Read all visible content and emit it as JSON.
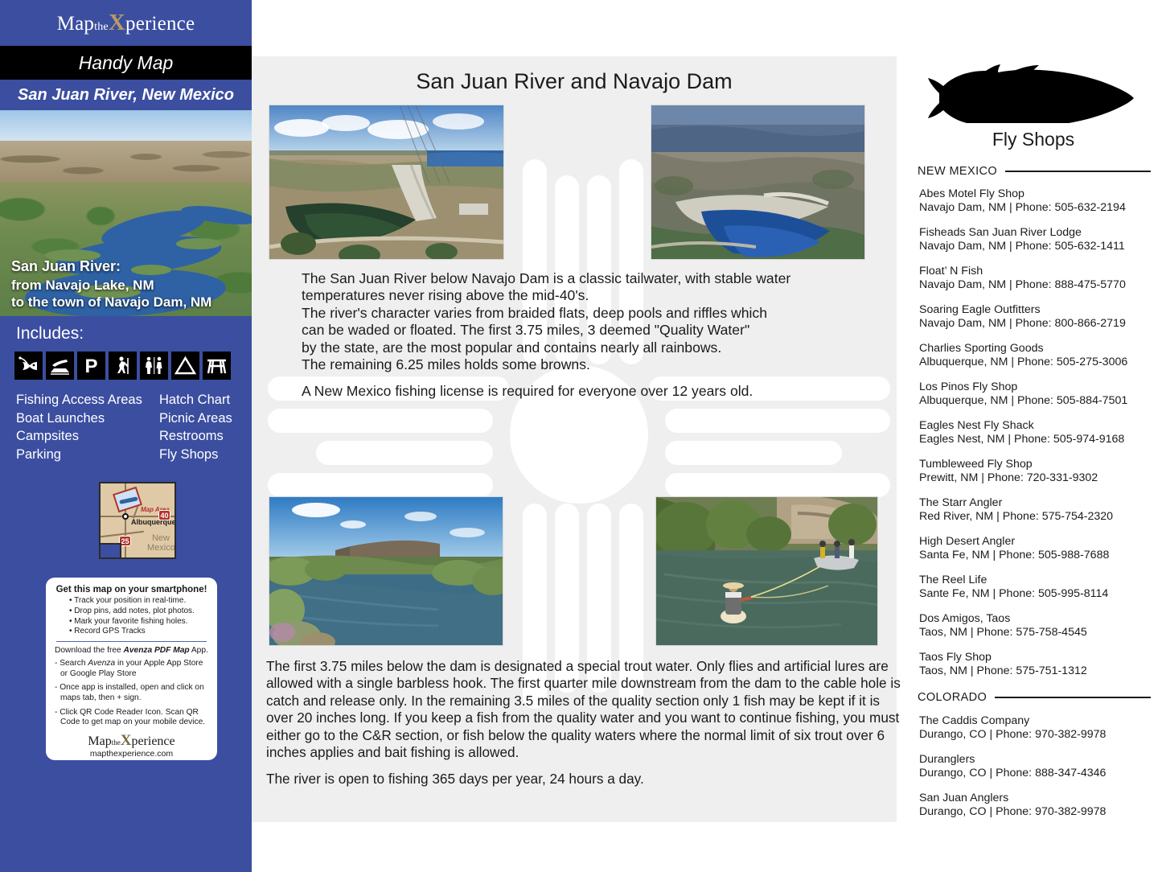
{
  "sidebar": {
    "brand": {
      "pre": "Map",
      "mid": "the",
      "x": "X",
      "post": "perience",
      "full": "MaptheXperience"
    },
    "handy_map": "Handy Map",
    "region_title": "San Juan River, New Mexico",
    "hero_caption": {
      "line1": "San Juan River:",
      "line2": "from Navajo Lake, NM",
      "line3": "to the town of Navajo Dam, NM"
    },
    "includes_label": "Includes:",
    "icons": [
      "fishing-icon",
      "boat-launch-icon",
      "parking-icon",
      "hiking-icon",
      "restrooms-icon",
      "camping-icon",
      "picnic-icon"
    ],
    "features_left": [
      "Fishing Access Areas",
      "Boat Launches",
      "Campsites",
      "Parking"
    ],
    "features_right": [
      "Hatch Chart",
      "Picnic Areas",
      "Restrooms",
      "Fly Shops"
    ],
    "state_map": {
      "map_area_label": "Map Area",
      "city": "Albuquerque",
      "state_line1": "New",
      "state_line2": "Mexico",
      "shield_40": "40",
      "shield_25": "25"
    },
    "promo": {
      "heading": "Get this map on your smartphone!",
      "bullets": [
        "Track your position in real-time.",
        "Drop pins, add notes, plot photos.",
        "Mark your favorite fishing holes.",
        "Record GPS Tracks"
      ],
      "download_pre": "Download the free ",
      "download_app": "Avenza PDF Map",
      "download_post": " App.",
      "steps": [
        "- Search Avenza in your Apple App Store or Google Play Store",
        "- Once app is installed, open and click on maps tab, then + sign.",
        "- Click QR Code Reader Icon. Scan QR Code to get map on your mobile device."
      ],
      "step1_pre": "- Search ",
      "step1_em": "Avenza",
      "step1_post": " in your Apple App Store or Google Play Store",
      "step2": "- Once app is installed, open and click on maps tab, then + sign.",
      "step3": "- Click QR Code Reader Icon. Scan QR Code to get map on your mobile device.",
      "url": "mapthexperience.com"
    }
  },
  "main": {
    "title": "San Juan River and Navajo Dam",
    "photos": [
      {
        "name": "navajo-dam-aerial-photo",
        "alt": "Aerial view of Navajo Dam spillway and reservoir"
      },
      {
        "name": "navajo-lake-aerial-photo",
        "alt": "Aerial view of Navajo Lake and canyon"
      },
      {
        "name": "san-juan-river-photo",
        "alt": "San Juan River with mesa backdrop"
      },
      {
        "name": "fly-angler-photo",
        "alt": "Fly angler wading with drift boat upstream"
      }
    ],
    "text_top": [
      "The San Juan River below Navajo Dam is a classic tailwater, with stable water temperatures never rising above the mid-40's.",
      "The river's character varies from braided flats, deep pools and riffles which can be waded or floated.  The first 3.75 miles, 3 deemed \"Quality Water\" by the state, are the most popular and contains nearly all rainbows.",
      "The remaining 6.25 miles holds some browns.",
      "A New Mexico fishing license is required for everyone over 12 years old."
    ],
    "text_top_lines": [
      "The San Juan River below Navajo Dam is a classic tailwater, with stable water",
      "temperatures never rising above the mid-40's.",
      "The river's character varies from braided flats, deep pools and riffles which",
      "can be waded or floated.  The first 3.75 miles, 3 deemed \"Quality Water\"",
      "by the state, are the most popular and contains nearly all rainbows.",
      "The remaining 6.25 miles holds some browns."
    ],
    "text_top_license": "A New Mexico fishing license is required for everyone over 12 years old.",
    "text_bottom_main": "The first 3.75 miles below the dam is designated a special trout water. Only flies and artificial lures are  allowed with a single barbless hook. The first quarter mile downstream from the dam to the cable hole is catch and release only. In the remaining 3.5 miles of the quality section only 1 fish may be kept if it is over 20 inches long. If you keep a fish from the quality water and you want to continue fishing, you must either go to the C&R section, or fish below the quality waters where the normal limit of six trout over 6 inches applies and bait fishing is allowed.",
    "text_bottom_hours": "The river is open to fishing 365 days per year, 24 hours a day."
  },
  "flyshops": {
    "fish_icon": "trout-silhouette-icon",
    "heading": "Fly Shops",
    "sections": [
      {
        "state": "NEW MEXICO",
        "shops": [
          {
            "name": "Abes Motel Fly Shop",
            "location": "Navajo Dam, NM | Phone: 505-632-2194"
          },
          {
            "name": "Fisheads San Juan River Lodge",
            "location": "Navajo Dam, NM | Phone: 505-632-1411"
          },
          {
            "name": "Float’ N Fish",
            "location": "Navajo Dam, NM | Phone: 888-475-5770"
          },
          {
            "name": "Soaring Eagle Outfitters",
            "location": "Navajo Dam, NM | Phone: 800-866-2719"
          },
          {
            "name": "Charlies Sporting Goods",
            "location": "Albuquerque, NM | Phone: 505-275-3006"
          },
          {
            "name": "Los Pinos Fly Shop",
            "location": "Albuquerque, NM | Phone: 505-884-7501"
          },
          {
            "name": "Eagles Nest Fly Shack",
            "location": "Eagles Nest, NM | Phone: 505-974-9168"
          },
          {
            "name": "Tumbleweed Fly Shop",
            "location": "Prewitt, NM | Phone: 720-331-9302"
          },
          {
            "name": "The Starr Angler",
            "location": "Red River, NM | Phone: 575-754-2320"
          },
          {
            "name": "High Desert Angler",
            "location": "Santa Fe, NM | Phone: 505-988-7688"
          },
          {
            "name": "The Reel Life",
            "location": "Sante Fe, NM | Phone: 505-995-8114"
          },
          {
            "name": "Dos Amigos, Taos",
            "location": "Taos, NM | Phone: 575-758-4545"
          },
          {
            "name": "Taos Fly Shop",
            "location": "Taos, NM | Phone: 575-751-1312"
          }
        ]
      },
      {
        "state": "COLORADO",
        "shops": [
          {
            "name": "The Caddis Company",
            "location": "Durango, CO | Phone: 970-382-9978"
          },
          {
            "name": "Duranglers",
            "location": "Durango, CO | Phone: 888-347-4346"
          },
          {
            "name": "San Juan Anglers",
            "location": "Durango, CO | Phone: 970-382-9978"
          }
        ]
      }
    ]
  },
  "colors": {
    "brand_blue": "#3b4ea0",
    "gray_panel": "#efefef",
    "gold": "#b79b62",
    "black_bar": "#000000"
  }
}
